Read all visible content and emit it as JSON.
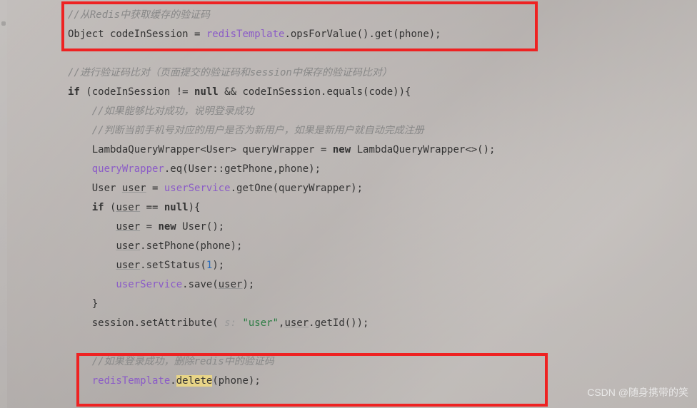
{
  "code": {
    "l1": "//从Redis中获取缓存的验证码",
    "l2a": "Object codeInSession = ",
    "l2b": "redisTemplate",
    "l2c": ".opsForValue().get(phone);",
    "l3": "",
    "l4": "//进行验证码比对（页面提交的验证码和session中保存的验证码比对）",
    "l5a": "if",
    "l5b": " (codeInSession != ",
    "l5c": "null",
    "l5d": " && codeInSession.equals(code)){",
    "l6": "    //如果能够比对成功，说明登录成功",
    "l7": "    //判断当前手机号对应的用户是否为新用户，如果是新用户就自动完成注册",
    "l8a": "    LambdaQueryWrapper<User> queryWrapper = ",
    "l8b": "new",
    "l8c": " LambdaQueryWrapper<>();",
    "l9a": "    queryWrapper",
    "l9b": ".eq(User::getPhone,phone);",
    "l10a": "    User ",
    "l10u": "user",
    "l10b": " = ",
    "l10c": "userService",
    "l10d": ".getOne(queryWrapper);",
    "l11a": "    if",
    "l11b": " (",
    "l11u": "user",
    "l11c": " == ",
    "l11d": "null",
    "l11e": "){",
    "l12a": "        ",
    "l12u": "user",
    "l12b": " = ",
    "l12c": "new",
    "l12d": " User();",
    "l13a": "        ",
    "l13u": "user",
    "l13b": ".setPhone(phone);",
    "l14a": "        ",
    "l14u": "user",
    "l14b": ".setStatus(",
    "l14n": "1",
    "l14c": ");",
    "l15a": "        userService",
    "l15b": ".save(",
    "l15u": "user",
    "l15c": ");",
    "l16": "    }",
    "l17a": "    session.setAttribute(",
    "l17h": " s: ",
    "l17s": "\"user\"",
    "l17b": ",",
    "l17u": "user",
    "l17c": ".getId());",
    "l18": "",
    "l19": "    //如果登录成功，删除redis中的验证码",
    "l20a": "    redisTemplate",
    "l20b": ".",
    "l20c": "delete",
    "l20d": "(phone);"
  },
  "watermark": "CSDN @随身携带的笑"
}
